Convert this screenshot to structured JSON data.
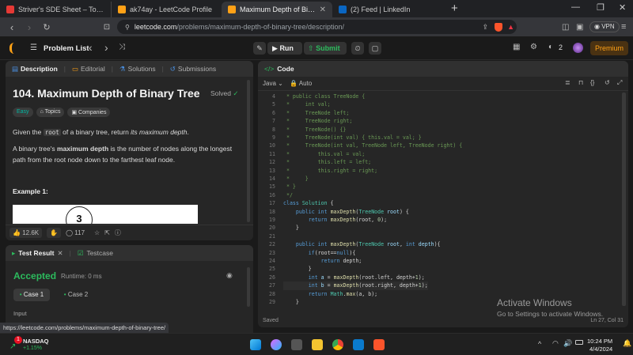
{
  "browser": {
    "tabs": [
      {
        "title": "Striver's SDE Sheet – Top Coding Int",
        "color": "#e53935"
      },
      {
        "title": "ak74ay - LeetCode Profile",
        "color": "#ffa116"
      },
      {
        "title": "Maximum Depth of Binary Tree",
        "color": "#ffa116",
        "active": true
      },
      {
        "title": "(2) Feed | LinkedIn",
        "color": "#0a66c2"
      }
    ],
    "url_host": "leetcode.com",
    "url_path": "/problems/maximum-depth-of-binary-tree/description/",
    "vpn_label": "VPN"
  },
  "lc_nav": {
    "problem_list": "Problem List",
    "run": "Run",
    "submit": "Submit",
    "notif_count": "2",
    "premium": "Premium"
  },
  "description": {
    "tabs": [
      "Description",
      "Editorial",
      "Solutions",
      "Submissions"
    ],
    "title": "104. Maximum Depth of Binary Tree",
    "solved": "Solved",
    "tags": [
      "Easy",
      "Topics",
      "Companies"
    ],
    "para1_a": "Given the ",
    "para1_code": "root",
    "para1_b": " of a binary tree, return ",
    "para1_em": "its maximum depth",
    "para1_c": ".",
    "para2_a": "A binary tree's ",
    "para2_b": "maximum depth",
    "para2_c": " is the number of nodes along the longest path from the root node down to the farthest leaf node.",
    "example": "Example 1:",
    "tree_node": "3",
    "likes": "12.6K",
    "comments": "117"
  },
  "testpanel": {
    "tabs": [
      "Test Result",
      "Testcase"
    ],
    "status": "Accepted",
    "runtime": "Runtime: 0 ms",
    "cases": [
      "Case 1",
      "Case 2"
    ],
    "input_label": "Input"
  },
  "editor": {
    "header": "Code",
    "language": "Java",
    "mode": "Auto",
    "saved": "Saved",
    "cursor": "Ln 27, Col 31",
    "watermark_title": "Activate Windows",
    "watermark_sub": "Go to Settings to activate Windows.",
    "lines": [
      {
        "n": "4",
        "t": [
          [
            "cm",
            " * public class TreeNode {"
          ]
        ]
      },
      {
        "n": "5",
        "t": [
          [
            "cm",
            " *     int val;"
          ]
        ]
      },
      {
        "n": "6",
        "t": [
          [
            "cm",
            " *     TreeNode left;"
          ]
        ]
      },
      {
        "n": "7",
        "t": [
          [
            "cm",
            " *     TreeNode right;"
          ]
        ]
      },
      {
        "n": "8",
        "t": [
          [
            "cm",
            " *     TreeNode() {}"
          ]
        ]
      },
      {
        "n": "9",
        "t": [
          [
            "cm",
            " *     TreeNode(int val) { this.val = val; }"
          ]
        ]
      },
      {
        "n": "10",
        "t": [
          [
            "cm",
            " *     TreeNode(int val, TreeNode left, TreeNode right) {"
          ]
        ]
      },
      {
        "n": "11",
        "t": [
          [
            "cm",
            " *         this.val = val;"
          ]
        ]
      },
      {
        "n": "12",
        "t": [
          [
            "cm",
            " *         this.left = left;"
          ]
        ]
      },
      {
        "n": "13",
        "t": [
          [
            "cm",
            " *         this.right = right;"
          ]
        ]
      },
      {
        "n": "14",
        "t": [
          [
            "cm",
            " *     }"
          ]
        ]
      },
      {
        "n": "15",
        "t": [
          [
            "cm",
            " * }"
          ]
        ]
      },
      {
        "n": "16",
        "t": [
          [
            "cm",
            " */"
          ]
        ]
      },
      {
        "n": "17",
        "t": [
          [
            "kw",
            "class "
          ],
          [
            "ty",
            "Solution "
          ],
          [
            "pl",
            "{"
          ]
        ]
      },
      {
        "n": "18",
        "t": [
          [
            "pl",
            "    "
          ],
          [
            "kw",
            "public int "
          ],
          [
            "fn",
            "maxDepth"
          ],
          [
            "pl",
            "("
          ],
          [
            "ty",
            "TreeNode "
          ],
          [
            "vr",
            "root"
          ],
          [
            "pl",
            ") {"
          ]
        ]
      },
      {
        "n": "19",
        "t": [
          [
            "pl",
            "        "
          ],
          [
            "kw",
            "return "
          ],
          [
            "fn",
            "maxDepth"
          ],
          [
            "pl",
            "(root, "
          ],
          [
            "nm",
            "0"
          ],
          [
            "pl",
            ");"
          ]
        ]
      },
      {
        "n": "20",
        "t": [
          [
            "pl",
            "    }"
          ]
        ]
      },
      {
        "n": "21",
        "t": [
          [
            "pl",
            ""
          ]
        ]
      },
      {
        "n": "22",
        "t": [
          [
            "pl",
            "    "
          ],
          [
            "kw",
            "public int "
          ],
          [
            "fn",
            "maxDepth"
          ],
          [
            "pl",
            "("
          ],
          [
            "ty",
            "TreeNode "
          ],
          [
            "vr",
            "root"
          ],
          [
            "pl",
            ", "
          ],
          [
            "kw",
            "int "
          ],
          [
            "vr",
            "depth"
          ],
          [
            "pl",
            "){"
          ]
        ]
      },
      {
        "n": "23",
        "t": [
          [
            "pl",
            "        "
          ],
          [
            "kw",
            "if"
          ],
          [
            "pl",
            "(root=="
          ],
          [
            "kw",
            "null"
          ],
          [
            "pl",
            "){"
          ]
        ]
      },
      {
        "n": "24",
        "t": [
          [
            "pl",
            "            "
          ],
          [
            "kw",
            "return "
          ],
          [
            "pl",
            "depth;"
          ]
        ]
      },
      {
        "n": "25",
        "t": [
          [
            "pl",
            "        }"
          ]
        ]
      },
      {
        "n": "26",
        "t": [
          [
            "pl",
            "        "
          ],
          [
            "kw",
            "int "
          ],
          [
            "vr",
            "a "
          ],
          [
            "pl",
            "= "
          ],
          [
            "fn",
            "maxDepth"
          ],
          [
            "pl",
            "(root.left, depth+"
          ],
          [
            "nm",
            "1"
          ],
          [
            "pl",
            ");"
          ]
        ]
      },
      {
        "n": "27",
        "t": [
          [
            "pl",
            "        "
          ],
          [
            "kw",
            "int "
          ],
          [
            "vr",
            "b "
          ],
          [
            "pl",
            "= "
          ],
          [
            "fn",
            "maxDepth"
          ],
          [
            "pl",
            "(root.right, depth+"
          ],
          [
            "nm",
            "1"
          ],
          [
            "pl",
            ");"
          ]
        ]
      },
      {
        "n": "28",
        "t": [
          [
            "pl",
            "        "
          ],
          [
            "kw",
            "return "
          ],
          [
            "ty",
            "Math"
          ],
          [
            "pl",
            "."
          ],
          [
            "fn",
            "max"
          ],
          [
            "pl",
            "(a, b);"
          ]
        ]
      },
      {
        "n": "29",
        "t": [
          [
            "pl",
            "    }"
          ]
        ]
      }
    ]
  },
  "status_url": "https://leetcode.com/problems/maximum-depth-of-binary-tree/",
  "taskbar": {
    "ticker": "NASDAQ",
    "change": "+1.15%",
    "badge": "1",
    "time": "10:24 PM",
    "date": "4/4/2024"
  }
}
